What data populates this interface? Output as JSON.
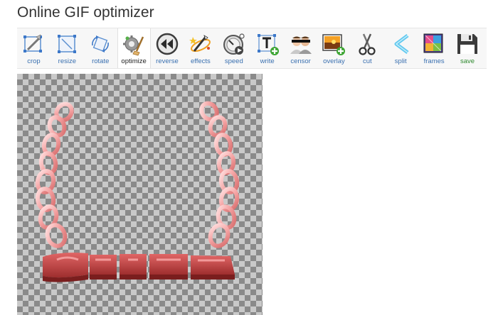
{
  "page": {
    "title": "Online GIF optimizer"
  },
  "toolbar": {
    "tools": [
      {
        "key": "crop",
        "label": "crop",
        "icon": "crop-icon"
      },
      {
        "key": "resize",
        "label": "resize",
        "icon": "resize-icon"
      },
      {
        "key": "rotate",
        "label": "rotate",
        "icon": "rotate-icon"
      },
      {
        "key": "optimize",
        "label": "optimize",
        "icon": "optimize-icon"
      },
      {
        "key": "reverse",
        "label": "reverse",
        "icon": "reverse-icon"
      },
      {
        "key": "effects",
        "label": "effects",
        "icon": "effects-icon"
      },
      {
        "key": "speed",
        "label": "speed",
        "icon": "speed-icon"
      },
      {
        "key": "write",
        "label": "write",
        "icon": "write-icon"
      },
      {
        "key": "censor",
        "label": "censor",
        "icon": "censor-icon"
      },
      {
        "key": "overlay",
        "label": "overlay",
        "icon": "overlay-icon"
      },
      {
        "key": "cut",
        "label": "cut",
        "icon": "cut-icon"
      },
      {
        "key": "split",
        "label": "split",
        "icon": "split-icon"
      },
      {
        "key": "frames",
        "label": "frames",
        "icon": "frames-icon"
      },
      {
        "key": "save",
        "label": "save",
        "icon": "save-icon"
      }
    ],
    "active": "optimize"
  },
  "colors": {
    "link_label": "#3a70b0",
    "save_label": "#2f8a2f",
    "chain_pink": "#f4a3a3",
    "letters_red": "#c94444"
  }
}
